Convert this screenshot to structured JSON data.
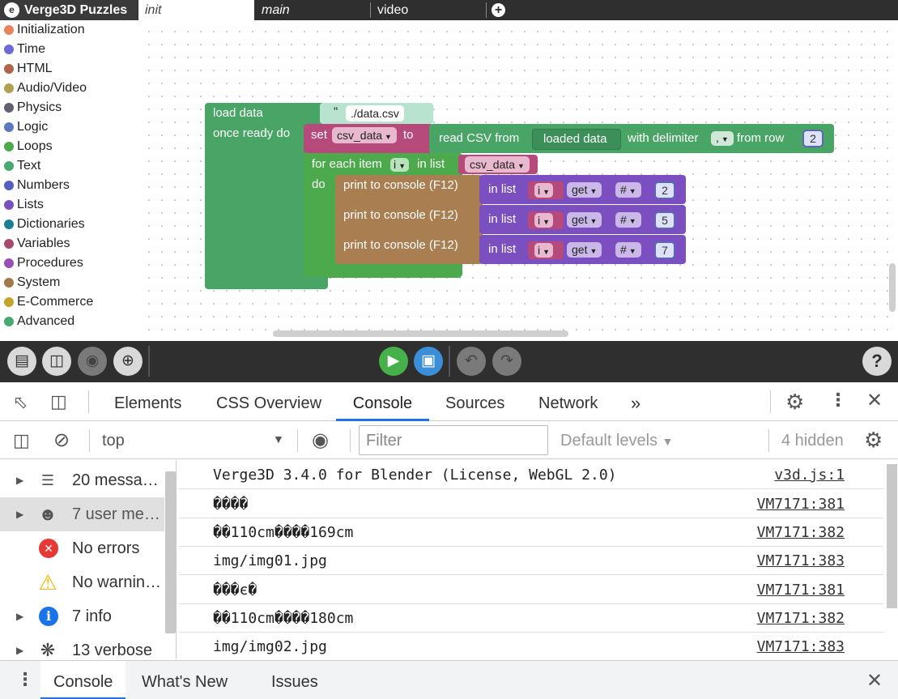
{
  "puzzles": {
    "logo_icon": "e",
    "logo_label": "Verge3D Puzzles",
    "tabs": [
      {
        "label": "init",
        "active": true
      },
      {
        "label": "main",
        "active": false
      },
      {
        "label": "video",
        "active": false
      }
    ],
    "add_tab_icon": "plus-icon",
    "categories": [
      {
        "label": "Initialization",
        "color": "#e8825a"
      },
      {
        "label": "Time",
        "color": "#6a6ad8"
      },
      {
        "label": "HTML",
        "color": "#b0644a"
      },
      {
        "label": "Audio/Video",
        "color": "#b0a050"
      },
      {
        "label": "Physics",
        "color": "#606070"
      },
      {
        "label": "Logic",
        "color": "#5b78c0"
      },
      {
        "label": "Loops",
        "color": "#4caa4c"
      },
      {
        "label": "Text",
        "color": "#47aa6e"
      },
      {
        "label": "Numbers",
        "color": "#5460c0"
      },
      {
        "label": "Lists",
        "color": "#7b4fbf"
      },
      {
        "label": "Dictionaries",
        "color": "#1c7e94"
      },
      {
        "label": "Variables",
        "color": "#a8486e"
      },
      {
        "label": "Procedures",
        "color": "#9a4fb6"
      },
      {
        "label": "System",
        "color": "#a07a48"
      },
      {
        "label": "E-Commerce",
        "color": "#c6a42a"
      },
      {
        "label": "Advanced",
        "color": "#47aa6e"
      }
    ],
    "blocks": {
      "load_data": "load data",
      "file_quote": "“",
      "file_path": "./data.csv",
      "once_ready": "once ready do",
      "set": "set",
      "var_csv": "csv_data",
      "to": "to",
      "read_csv": "read CSV from",
      "loaded_data": "loaded data",
      "with_delim": "with delimiter",
      "delim_value": ",",
      "from_row": "from row",
      "row_value": "2",
      "for_each": "for each item",
      "loop_var": "i",
      "in_list": "in list",
      "do": "do",
      "print_label": "print to console (F12)",
      "list_in": "in list",
      "get": "get",
      "hash": "#",
      "prints": [
        {
          "index": "2"
        },
        {
          "index": "5"
        },
        {
          "index": "7"
        }
      ]
    },
    "toolbar_colors": {
      "run": "#46b04a",
      "save": "#3b8fd9"
    }
  },
  "devtools": {
    "tabs": [
      "Elements",
      "CSS Overview",
      "Console",
      "Sources",
      "Network"
    ],
    "active_tab": "Console",
    "more_tabs": "»",
    "context": "top",
    "filter_placeholder": "Filter",
    "levels": "Default levels",
    "hidden": "4 hidden",
    "sidebar": [
      {
        "label": "20 messa…",
        "icon": "list-icon",
        "expandable": true,
        "selected": false
      },
      {
        "label": "7 user me…",
        "icon": "user-icon",
        "expandable": true,
        "selected": true
      },
      {
        "label": "No errors",
        "icon": "error-icon",
        "expandable": false,
        "selected": false
      },
      {
        "label": "No warnin…",
        "icon": "warning-icon",
        "expandable": false,
        "selected": false
      },
      {
        "label": "7 info",
        "icon": "info-icon",
        "expandable": true,
        "selected": false
      },
      {
        "label": "13 verbose",
        "icon": "bug-icon",
        "expandable": true,
        "selected": false
      }
    ],
    "messages": [
      {
        "text": "Verge3D 3.4.0 for Blender (License, WebGL 2.0)",
        "source": "v3d.js:1"
      },
      {
        "text": "����",
        "source": "VM7171:381"
      },
      {
        "text": "��110cm����169cm",
        "source": "VM7171:382"
      },
      {
        "text": "img/img01.jpg",
        "source": "VM7171:383"
      },
      {
        "text": "���є�",
        "source": "VM7171:381"
      },
      {
        "text": "��110cm����180cm",
        "source": "VM7171:382"
      },
      {
        "text": "img/img02.jpg",
        "source": "VM7171:383"
      }
    ],
    "drawer_tabs": [
      "Console",
      "What's New",
      "Issues"
    ],
    "drawer_active": "Console"
  }
}
